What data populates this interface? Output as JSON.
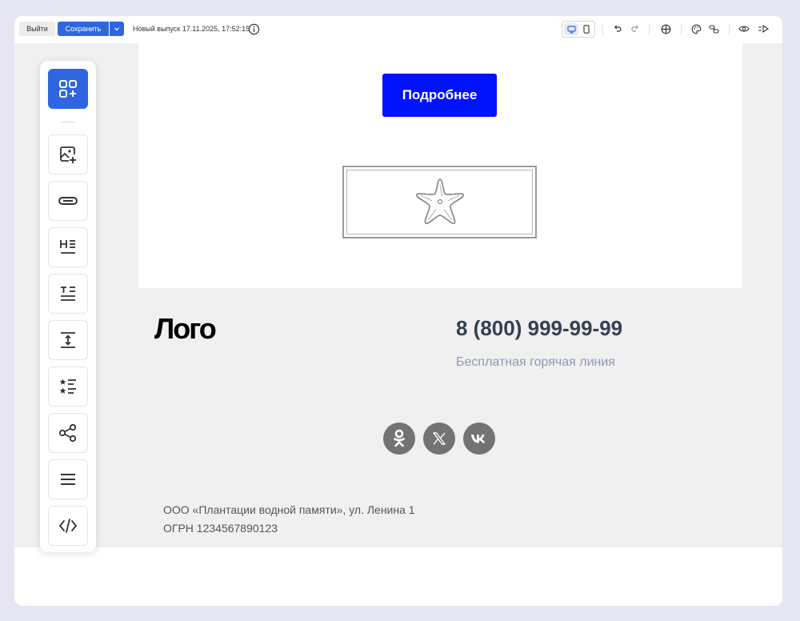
{
  "toolbar": {
    "exit_label": "Выйти",
    "save_label": "Сохранить",
    "release_text": "Новый выпуск 17.11.2025, 17:52:15"
  },
  "email": {
    "cta_label": "Подробнее",
    "logo_text": "Лого",
    "phone": "8 (800) 999-99-99",
    "hotline": "Бесплатная горячая линия",
    "company": "ООО «Плантации водной памяти», ул. Ленина 1",
    "ogrn": "ОГРН 1234567890123",
    "social": [
      "ok-icon",
      "x-icon",
      "vk-icon"
    ]
  },
  "panel": {
    "items": [
      "add-block-icon",
      "image-icon",
      "button-icon",
      "heading-icon",
      "text-icon",
      "spacer-icon",
      "list-icon",
      "share-icon",
      "menu-icon",
      "code-icon"
    ]
  },
  "colors": {
    "accent": "#2f66e0",
    "cta": "#0012ff",
    "social": "#737373",
    "footer_bg": "#f0f0f0"
  }
}
